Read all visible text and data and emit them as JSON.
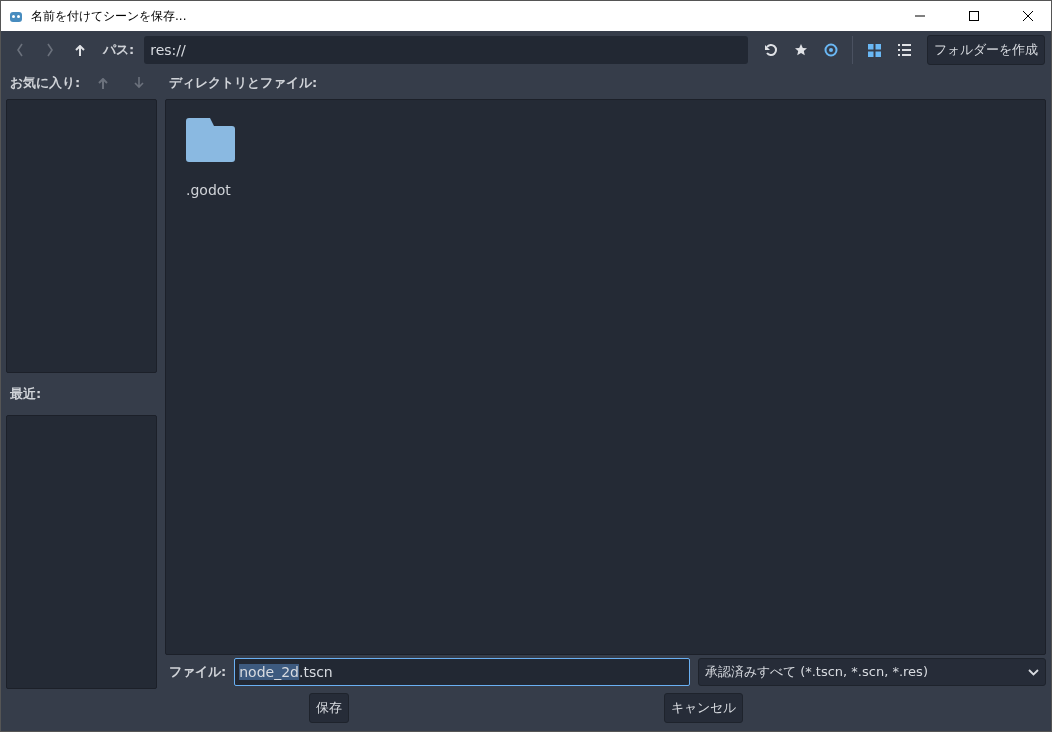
{
  "window": {
    "title": "名前を付けてシーンを保存..."
  },
  "toolbar": {
    "nav": [
      {
        "kind": "back",
        "disabled": true
      },
      {
        "kind": "forward",
        "disabled": true
      },
      {
        "kind": "up",
        "disabled": false
      }
    ],
    "path_label": "パス:",
    "path_value": "res://",
    "actions": [
      {
        "kind": "refresh",
        "on": false
      },
      {
        "kind": "favorite",
        "on": false
      },
      {
        "kind": "show_hidden",
        "on": true
      }
    ],
    "views": [
      {
        "kind": "grid",
        "selected": true
      },
      {
        "kind": "list",
        "selected": false
      }
    ],
    "create_folder": "フォルダーを作成"
  },
  "favorites": {
    "label": "お気に入り:",
    "move": [
      {
        "kind": "up",
        "disabled": true
      },
      {
        "kind": "down",
        "disabled": true
      }
    ]
  },
  "recent": {
    "label": "最近:"
  },
  "files": {
    "label": "ディレクトリとファイル:",
    "items": [
      {
        "kind": "folder",
        "name": ".godot"
      }
    ]
  },
  "file_field": {
    "label": "ファイル:",
    "parts": [
      {
        "text": "node_2d",
        "selected": true
      },
      {
        "text": ".tscn",
        "selected": false
      }
    ]
  },
  "filter": {
    "value": "承認済みすべて (*.tscn, *.scn, *.res)"
  },
  "buttons": [
    "保存",
    "キャンセル"
  ]
}
